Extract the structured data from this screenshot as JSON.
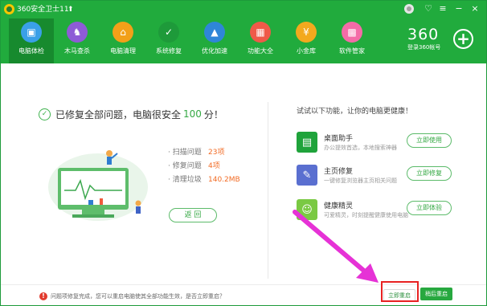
{
  "titlebar": {
    "app_title": "360安全卫士11"
  },
  "nav": {
    "items": [
      {
        "label": "电脑体检",
        "icon": "monitor-icon",
        "color": "#3aa0e8",
        "glyph": "▣"
      },
      {
        "label": "木马查杀",
        "icon": "horse-icon",
        "color": "#8e5bd6",
        "glyph": "♞"
      },
      {
        "label": "电脑清理",
        "icon": "broom-icon",
        "color": "#f2a019",
        "glyph": "⌂"
      },
      {
        "label": "系统修复",
        "icon": "shield-icon",
        "color": "#1e9a3a",
        "glyph": "✓"
      },
      {
        "label": "优化加速",
        "icon": "rocket-icon",
        "color": "#2f86d8",
        "glyph": "▲"
      },
      {
        "label": "功能大全",
        "icon": "grid-icon",
        "color": "#ef5a49",
        "glyph": "▦"
      },
      {
        "label": "小金库",
        "icon": "coin-bag-icon",
        "color": "#f3a91e",
        "glyph": "¥"
      },
      {
        "label": "软件管家",
        "icon": "app-store-icon",
        "color": "#f46ba7",
        "glyph": "▩"
      }
    ]
  },
  "brand": {
    "logo": "360",
    "account_label": "登录360帐号"
  },
  "result": {
    "prefix": "已修复全部问题，电脑很安全",
    "score": "100",
    "suffix": "分！"
  },
  "stats": [
    {
      "label": "· 扫描问题",
      "value": "23项"
    },
    {
      "label": "· 修复问题",
      "value": "4项"
    },
    {
      "label": "· 清理垃圾",
      "value": "140.2MB"
    }
  ],
  "return_label": "返 回",
  "suggest": {
    "title": "试试以下功能，让你的电脑更健康！",
    "features": [
      {
        "title": "桌面助手",
        "desc": "办公提效首选，本地搜索神器",
        "button": "立即使用",
        "icon": "desktop-assistant-icon",
        "color": "#1fa33b",
        "glyph": "▤"
      },
      {
        "title": "主页修复",
        "desc": "一键修复浏览器主页相关问题",
        "button": "立即修复",
        "icon": "wrench-icon",
        "color": "#5a6fd0",
        "glyph": "✎"
      },
      {
        "title": "健康精灵",
        "desc": "可爱精灵，时刻提醒健康使用电脑",
        "button": "立即体验",
        "icon": "health-elf-icon",
        "color": "#7ac943",
        "glyph": "☺"
      }
    ]
  },
  "bottom": {
    "notice": "问题项修复完成，您可以重启电脑使其全部功能生效，是否立即重启？",
    "restart_now": "立即重启",
    "restart_later": "稍后重启"
  }
}
